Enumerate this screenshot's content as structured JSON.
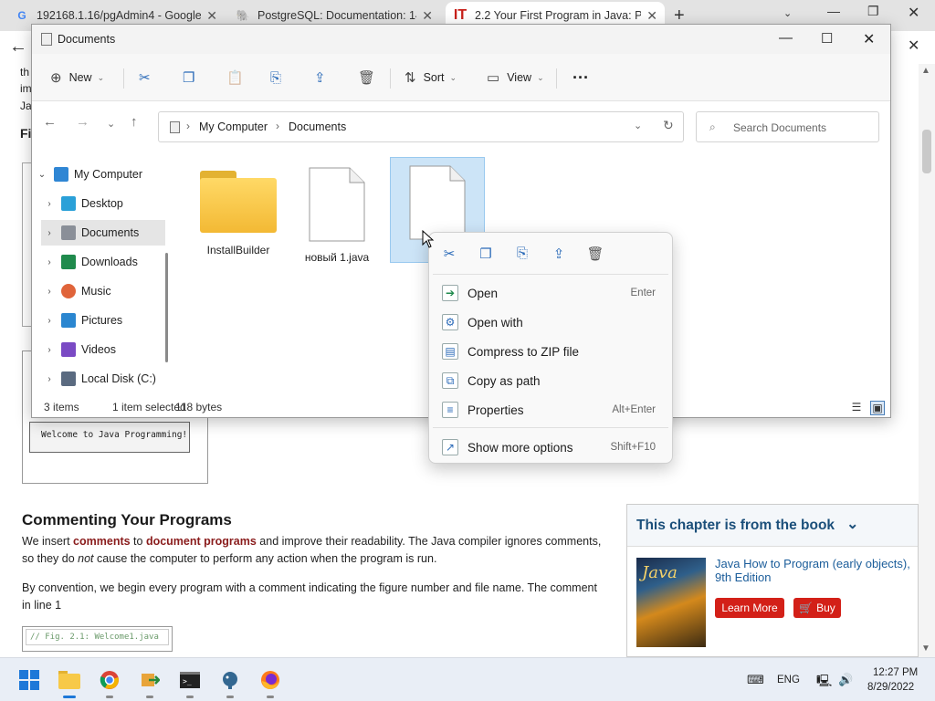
{
  "browser": {
    "tabs": [
      {
        "title": "192168.1.16/pgAdmin4 - Google",
        "favicon": "google-icon"
      },
      {
        "title": "PostgreSQL: Documentation: 14",
        "favicon": "postgresql-icon"
      },
      {
        "title": "2.2 Your First Program in Java: Pr",
        "favicon": "informit-icon"
      }
    ]
  },
  "page": {
    "left_fragments": [
      "th",
      "im",
      "Ja",
      "Fi"
    ],
    "code_sample": "Welcome to Java Programming!",
    "section_heading": "Commenting Your Programs",
    "para1_a": "We insert ",
    "para1_b": "comments",
    "para1_c": " to ",
    "para1_d": "document programs",
    "para1_e": " and improve their readability. The Java compiler ignores comments, so they do ",
    "para1_f": "not",
    "para1_g": " cause the computer to perform any action when the program is run.",
    "para2": "By convention, we begin every program with a comment indicating the figure number and file name. The comment in line 1",
    "code_line": "// Fig. 2.1: Welcome1.java",
    "book_panel": {
      "heading": "This chapter is from the book",
      "cover_text": "Java",
      "title": "Java How to Program (early objects), 9th Edition",
      "learn_more": "Learn More",
      "buy": "Buy"
    }
  },
  "explorer": {
    "title": "Documents",
    "toolbar": {
      "new_label": "New",
      "sort_label": "Sort",
      "view_label": "View"
    },
    "breadcrumb": [
      "My Computer",
      "Documents"
    ],
    "search_placeholder": "Search Documents",
    "tree": [
      {
        "label": "My Computer",
        "icon": "computer-icon",
        "color": "#2f86d4"
      },
      {
        "label": "Desktop",
        "icon": "desktop-icon",
        "color": "#2aa0d8"
      },
      {
        "label": "Documents",
        "icon": "documents-icon",
        "color": "#8a8f98"
      },
      {
        "label": "Downloads",
        "icon": "downloads-icon",
        "color": "#1f8a4c"
      },
      {
        "label": "Music",
        "icon": "music-icon",
        "color": "#e0643a"
      },
      {
        "label": "Pictures",
        "icon": "pictures-icon",
        "color": "#2a86d0"
      },
      {
        "label": "Videos",
        "icon": "videos-icon",
        "color": "#7a4ac4"
      },
      {
        "label": "Local Disk (C:)",
        "icon": "disk-icon",
        "color": "#5a6a80"
      }
    ],
    "files": [
      {
        "name": "InstallBuilder",
        "type": "folder"
      },
      {
        "name": "новый 1.java",
        "type": "file"
      },
      {
        "name": "",
        "type": "file"
      }
    ],
    "status": {
      "count": "3 items",
      "selection": "1 item selected",
      "size": "118 bytes"
    }
  },
  "context_menu": {
    "items": [
      {
        "label": "Open",
        "shortcut": "Enter",
        "icon": "open-icon"
      },
      {
        "label": "Open with",
        "shortcut": "",
        "icon": "open-with-icon"
      },
      {
        "label": "Compress to ZIP file",
        "shortcut": "",
        "icon": "zip-icon"
      },
      {
        "label": "Copy as path",
        "shortcut": "",
        "icon": "copy-path-icon"
      },
      {
        "label": "Properties",
        "shortcut": "Alt+Enter",
        "icon": "properties-icon"
      },
      {
        "label": "Show more options",
        "shortcut": "Shift+F10",
        "icon": "more-options-icon"
      }
    ]
  },
  "taskbar": {
    "lang": "ENG",
    "time": "12:27 PM",
    "date": "8/29/2022"
  }
}
